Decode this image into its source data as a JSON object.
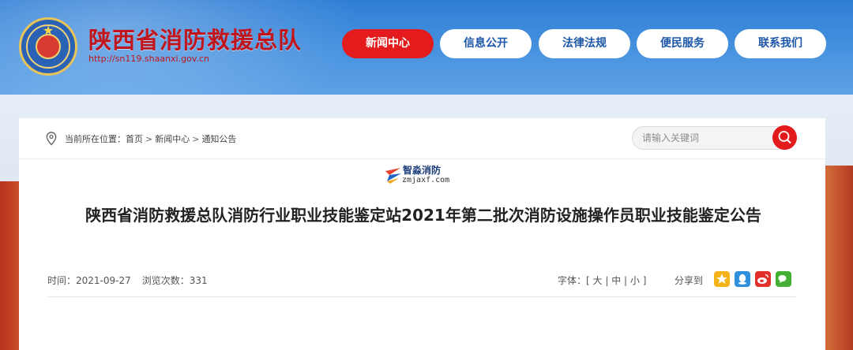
{
  "header": {
    "site_title": "陕西省消防救援总队",
    "site_url": "http://sn119.shaanxi.gov.cn",
    "nav": [
      {
        "label": "新闻中心",
        "active": true
      },
      {
        "label": "信息公开",
        "active": false
      },
      {
        "label": "法律法规",
        "active": false
      },
      {
        "label": "便民服务",
        "active": false
      },
      {
        "label": "联系我们",
        "active": false
      }
    ]
  },
  "breadcrumb": {
    "prefix": "当前所在位置：",
    "items": [
      "首页",
      "新闻中心",
      "通知公告"
    ],
    "separator": ">"
  },
  "search": {
    "placeholder": "请输入关键词",
    "value": ""
  },
  "watermark": {
    "name": "智淼消防",
    "url": "zmjaxf.com"
  },
  "article": {
    "title": "陕西省消防救援总队消防行业职业技能鉴定站2021年第二批次消防设施操作员职业技能鉴定公告",
    "time_label": "时间：",
    "time": "2021-09-27",
    "views_label": "浏览次数：",
    "views": "331",
    "font_label": "字体：",
    "font_options": [
      "大",
      "中",
      "小"
    ],
    "share_label": "分享到"
  },
  "colors": {
    "brand_red": "#e31b1c",
    "nav_blue_text": "#1c56a8",
    "header_blue": "#2f7ed6",
    "title_red": "#c0151d"
  },
  "icons": {
    "location": "location-pin-icon",
    "search": "search-icon",
    "share": [
      "qzone-star-icon",
      "qq-icon",
      "weibo-icon",
      "wechat-icon"
    ]
  }
}
